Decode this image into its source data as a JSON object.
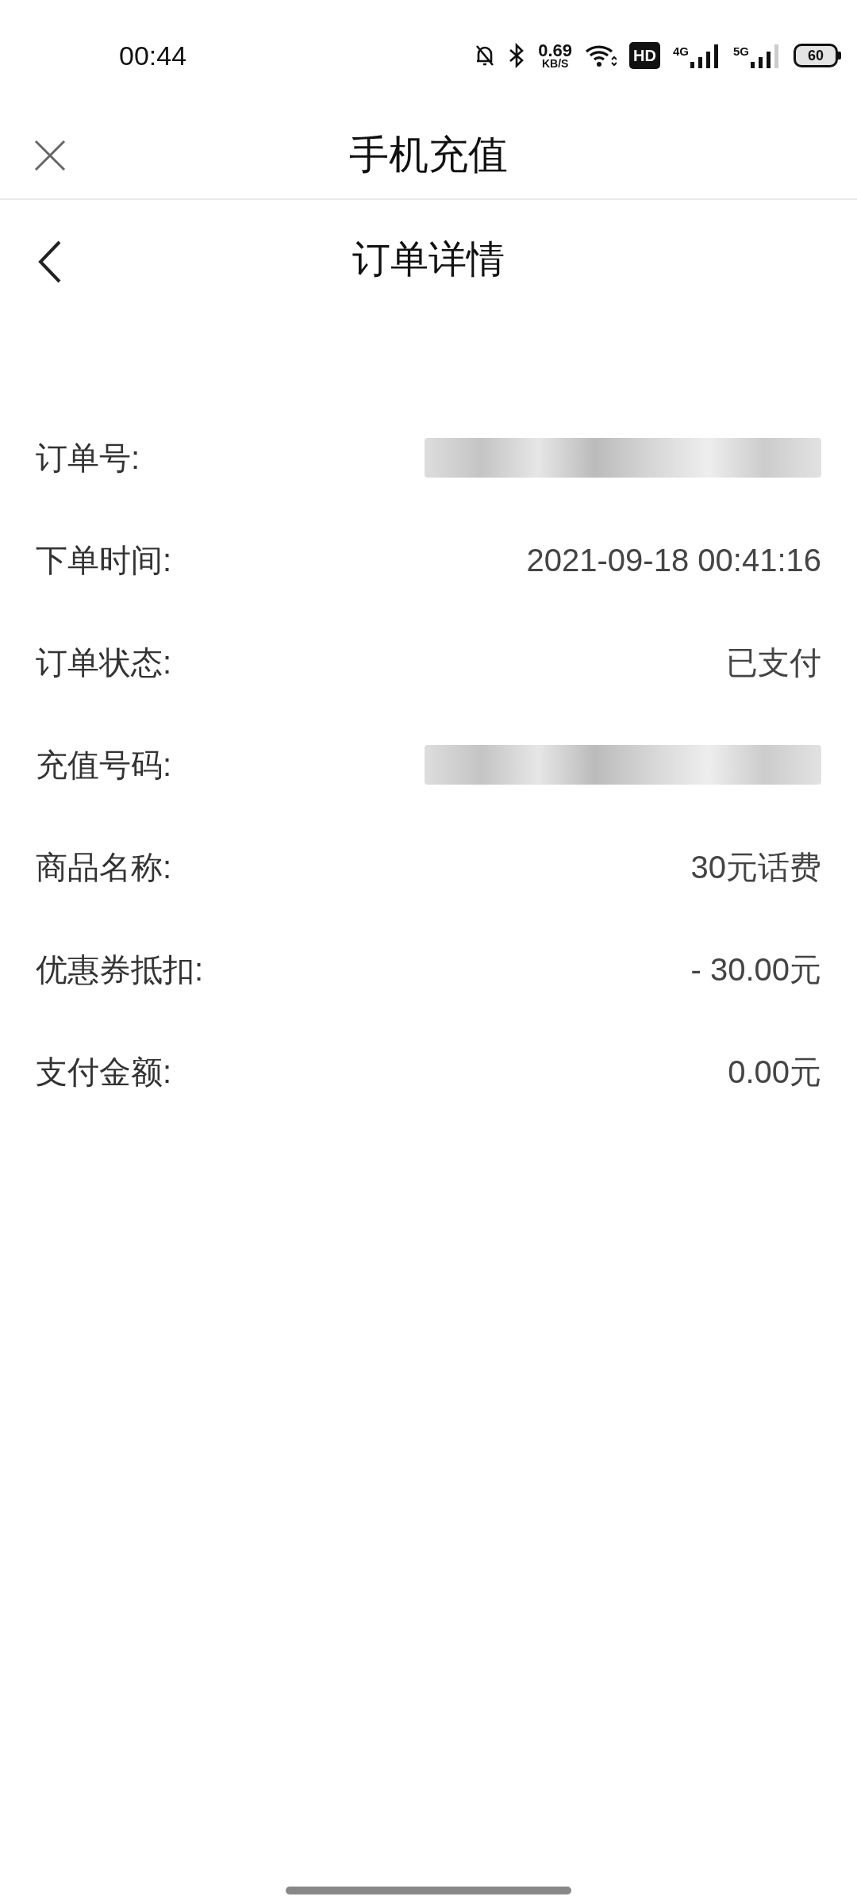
{
  "status_bar": {
    "time": "00:44",
    "speed_value": "0.69",
    "speed_unit": "KB/S",
    "hd_label": "HD",
    "net_4g": "4G",
    "net_5g": "5G",
    "battery": "60"
  },
  "top_bar": {
    "title": "手机充值"
  },
  "header": {
    "title": "订单详情"
  },
  "rows": [
    {
      "label": "订单号:",
      "kind": "redacted"
    },
    {
      "label": "下单时间:",
      "kind": "text",
      "value": "2021-09-18 00:41:16"
    },
    {
      "label": "订单状态:",
      "kind": "text",
      "value": "已支付"
    },
    {
      "label": "充值号码:",
      "kind": "redacted"
    },
    {
      "label": "商品名称:",
      "kind": "text",
      "value": "30元话费"
    },
    {
      "label": "优惠券抵扣:",
      "kind": "text",
      "value": "- 30.00元"
    },
    {
      "label": "支付金额:",
      "kind": "text",
      "value": "0.00元"
    }
  ]
}
